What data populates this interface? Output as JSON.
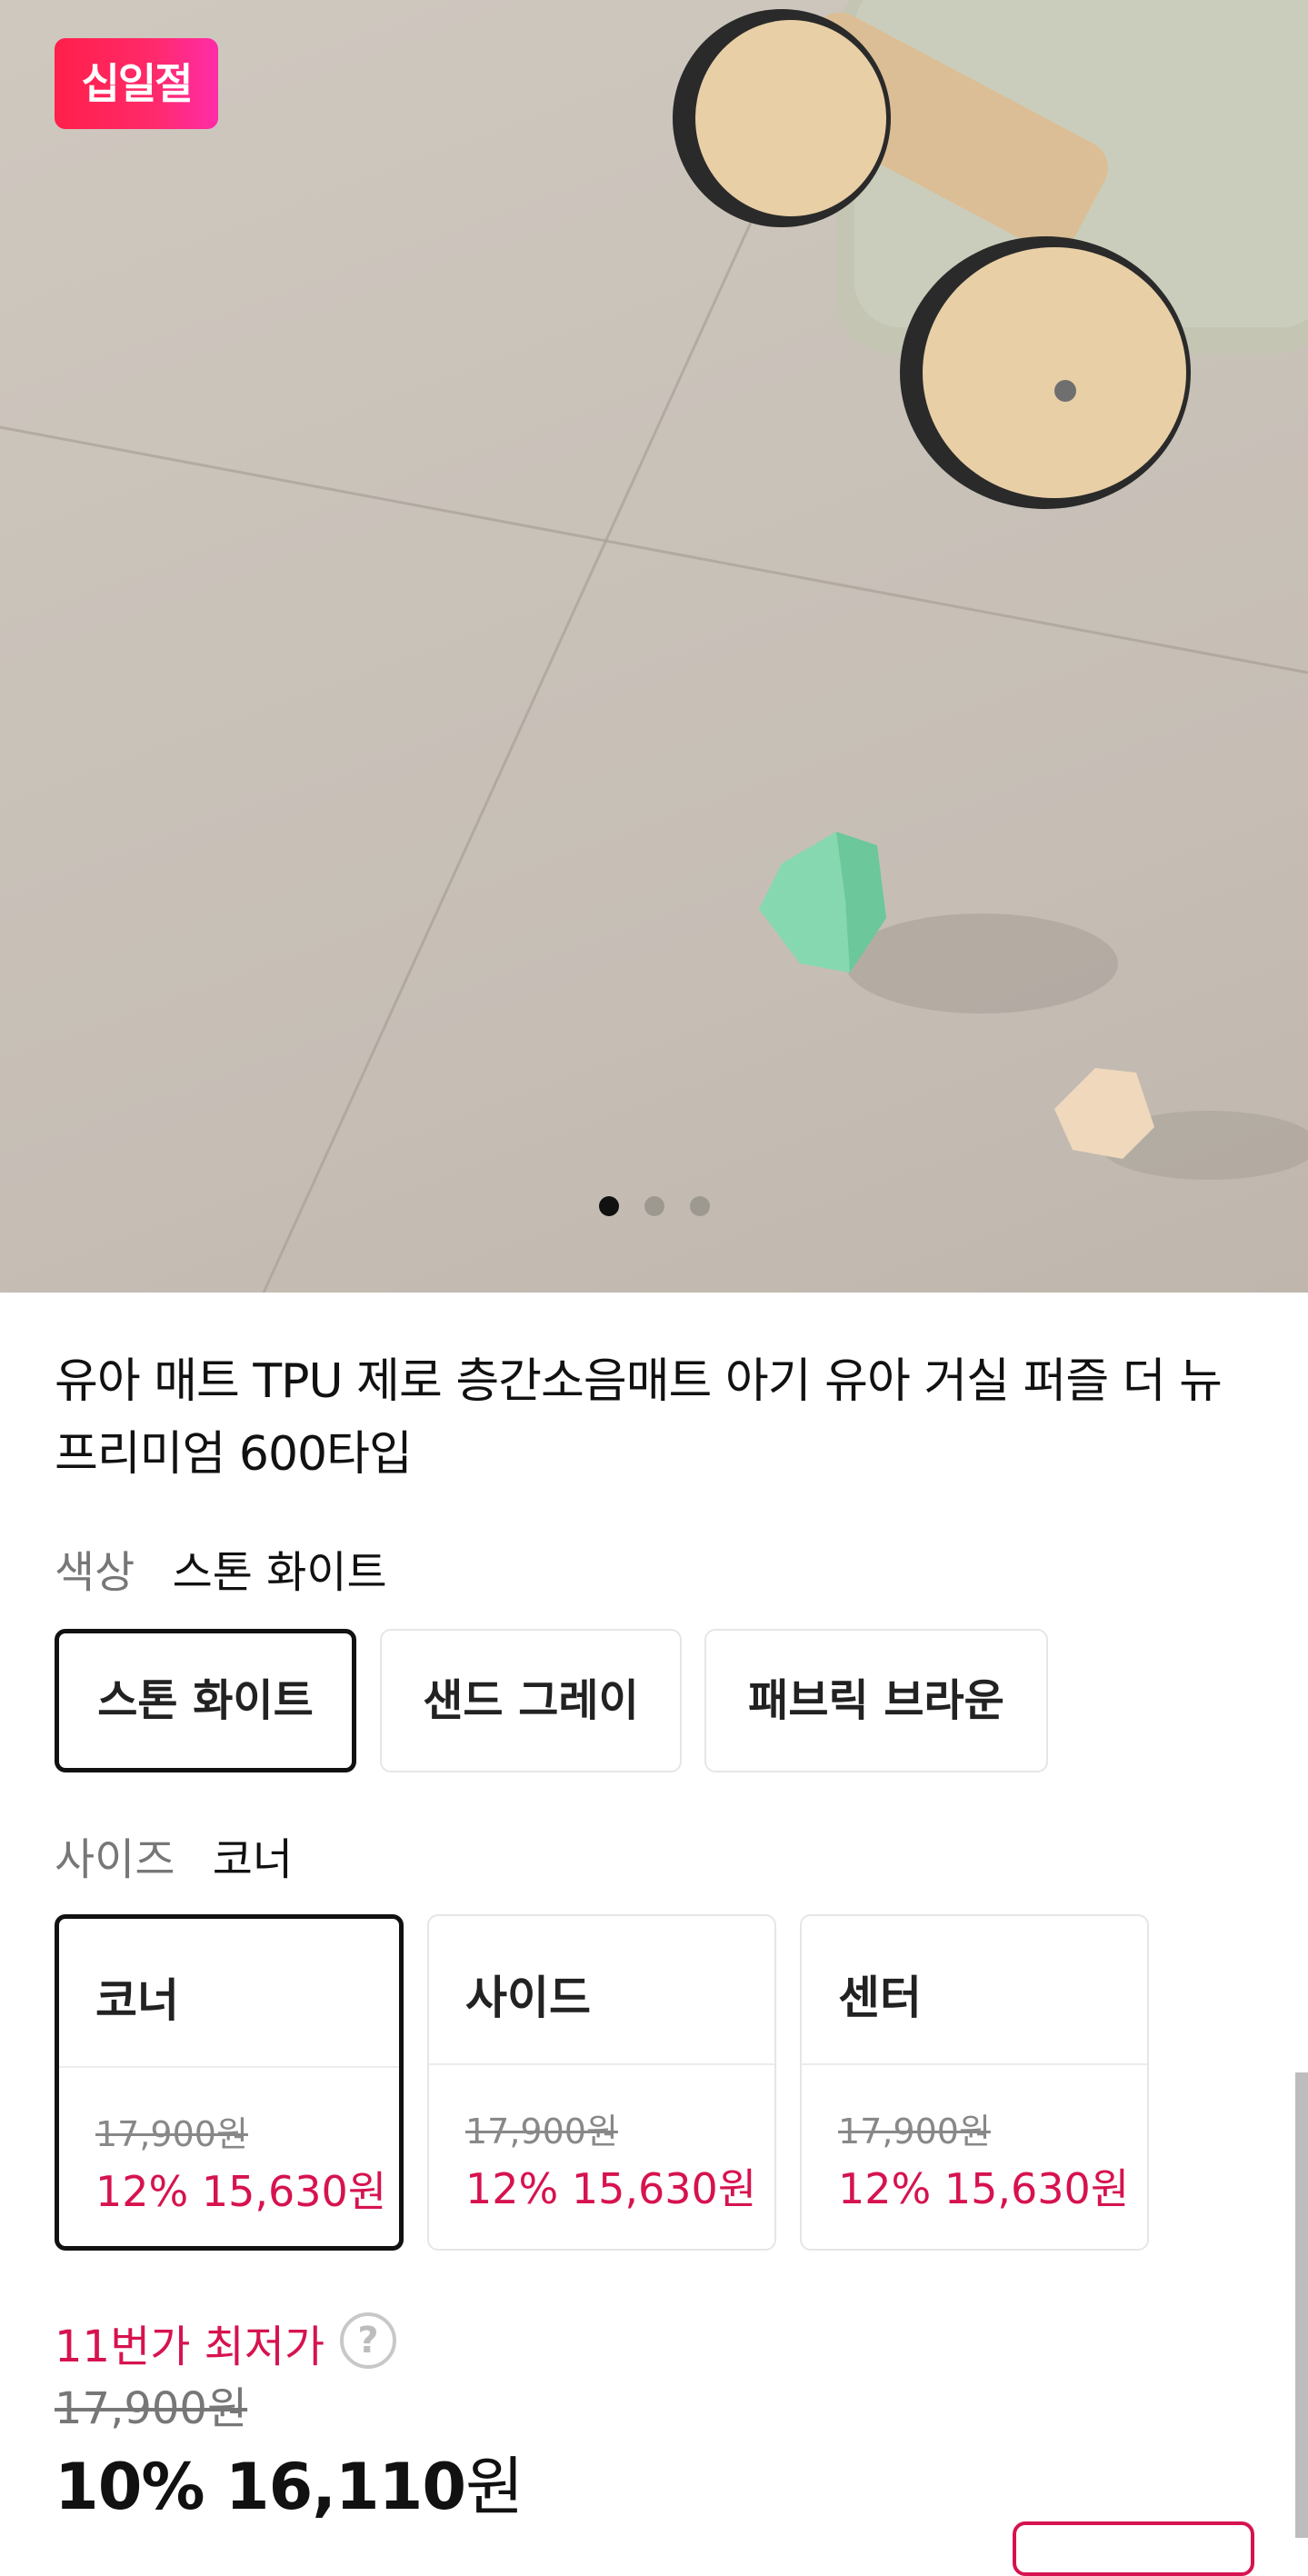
{
  "badge": {
    "label": "십일절"
  },
  "gallery": {
    "total_images": 3,
    "active_index": 0
  },
  "product": {
    "title": "유아 매트 TPU 제로 층간소음매트 아기 유아 거실 퍼즐 더 뉴프리미엄 600타입"
  },
  "color_option": {
    "label": "색상",
    "selected": "스톤 화이트",
    "choices": [
      "스톤 화이트",
      "샌드 그레이",
      "패브릭 브라운"
    ]
  },
  "size_option": {
    "label": "사이즈",
    "selected": "코너",
    "choices": [
      {
        "name": "코너",
        "original_price": "17,900원",
        "sale": "12% 15,630원"
      },
      {
        "name": "사이드",
        "original_price": "17,900원",
        "sale": "12% 15,630원"
      },
      {
        "name": "센터",
        "original_price": "17,900원",
        "sale": "12% 15,630원"
      }
    ]
  },
  "pricing": {
    "lowest_label": "11번가 최저가",
    "help_icon": "?",
    "original_price": "17,900원",
    "final_price": "10% 16,110",
    "final_currency": "원"
  },
  "colors": {
    "accent": "#d6134f",
    "badge": "#ff1f4a",
    "selected_border": "#111111"
  }
}
